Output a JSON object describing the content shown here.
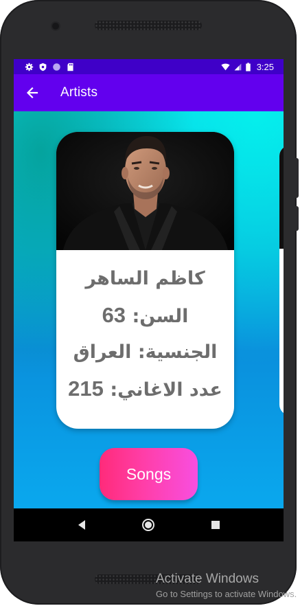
{
  "status_bar": {
    "time": "3:25",
    "icons": [
      "gear-icon",
      "shield-icon",
      "circle-icon",
      "sd-card-icon",
      "wifi-icon",
      "signal-icon",
      "battery-icon"
    ]
  },
  "app_bar": {
    "title": "Artists",
    "back_icon": "arrow-left-icon"
  },
  "artist_card": {
    "name": "كاظم الساهر",
    "age_label": "السن:",
    "age_value": "63",
    "nationality_label": "الجنسية:",
    "nationality_value": "العراق",
    "songs_label": "عدد الاغاني:",
    "songs_value": "215"
  },
  "actions": {
    "songs_label": "Songs"
  },
  "navigation": {
    "back_icon": "triangle-back-icon",
    "home_icon": "circle-home-icon",
    "recents_icon": "square-recents-icon"
  },
  "watermark": {
    "title": "Activate Windows",
    "subtitle": "Go to Settings to activate Windows."
  },
  "colors": {
    "status_bar": "#3f00c8",
    "app_bar": "#6200ee",
    "button_gradient_start": "#ff2b7a",
    "button_gradient_end": "#f84fe0",
    "card_text": "#6d6d6d"
  }
}
